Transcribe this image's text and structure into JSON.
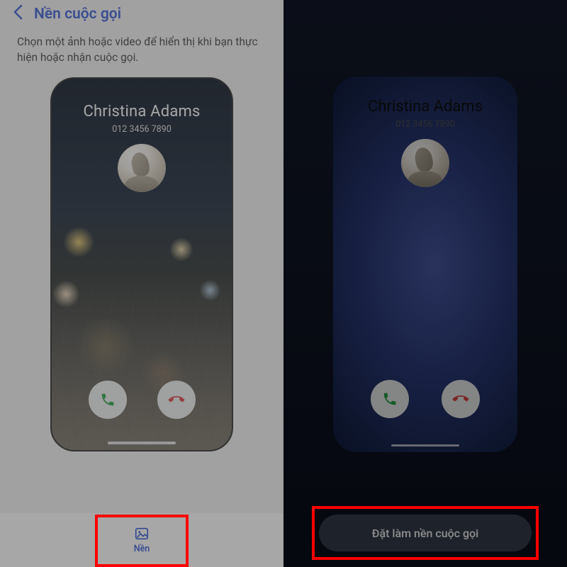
{
  "header": {
    "title": "Nền cuộc gọi"
  },
  "description": "Chọn một ảnh hoặc video để hiển thị khi bạn thực hiện hoặc nhận cuộc gọi.",
  "caller": {
    "name": "Christina Adams",
    "number": "012 3456 7890"
  },
  "left": {
    "tab_label": "Nền"
  },
  "right": {
    "apply_button": "Đặt làm nền cuộc gọi"
  },
  "colors": {
    "accent": "#3b5ed8",
    "accept": "#29a645",
    "decline": "#e04242",
    "highlight": "#ff0000"
  }
}
